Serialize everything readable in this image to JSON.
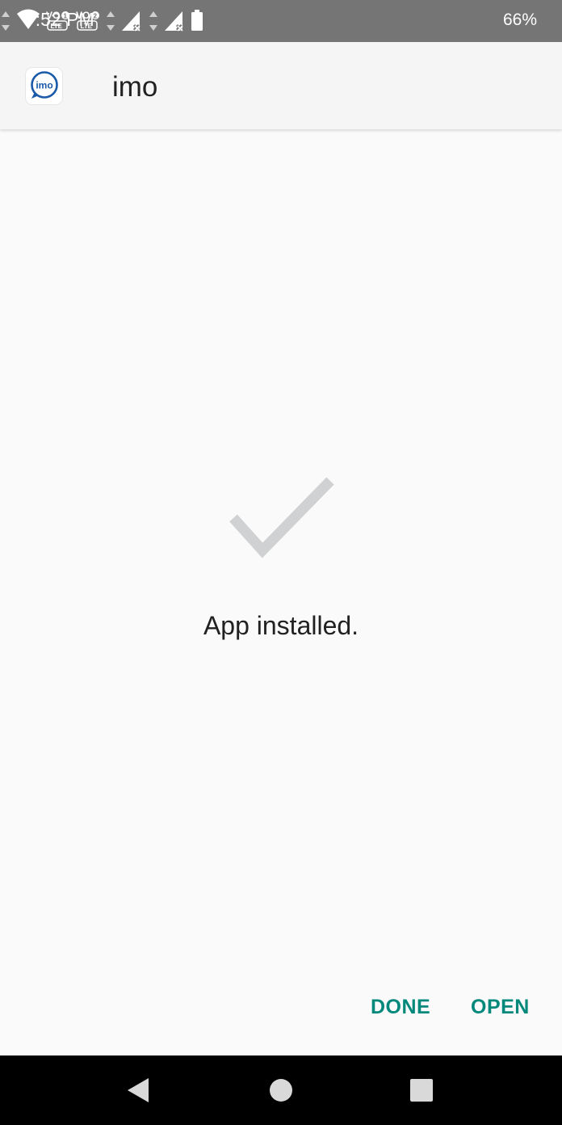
{
  "status_bar": {
    "time": "7:52 PM",
    "battery_percent": "66%",
    "sim1_label": "VO",
    "sim1_num": "1",
    "sim2_label": "VO",
    "sim2_num": "2",
    "lte_label": "LTE"
  },
  "header": {
    "app_name": "imo",
    "logo_text": "imo"
  },
  "content": {
    "message": "App installed."
  },
  "actions": {
    "done_label": "DONE",
    "open_label": "OPEN"
  },
  "colors": {
    "accent": "#00897b",
    "status_bar_bg": "#757575",
    "checkmark": "#cfd1d2",
    "logo_blue": "#1a5aa8"
  },
  "icons": {
    "status": [
      "data-arrows-icon",
      "wifi-icon",
      "volte-1-icon",
      "volte-2-icon",
      "signal-icon",
      "battery-icon"
    ],
    "center": "checkmark-icon",
    "nav": [
      "back-icon",
      "home-icon",
      "recents-icon"
    ]
  }
}
